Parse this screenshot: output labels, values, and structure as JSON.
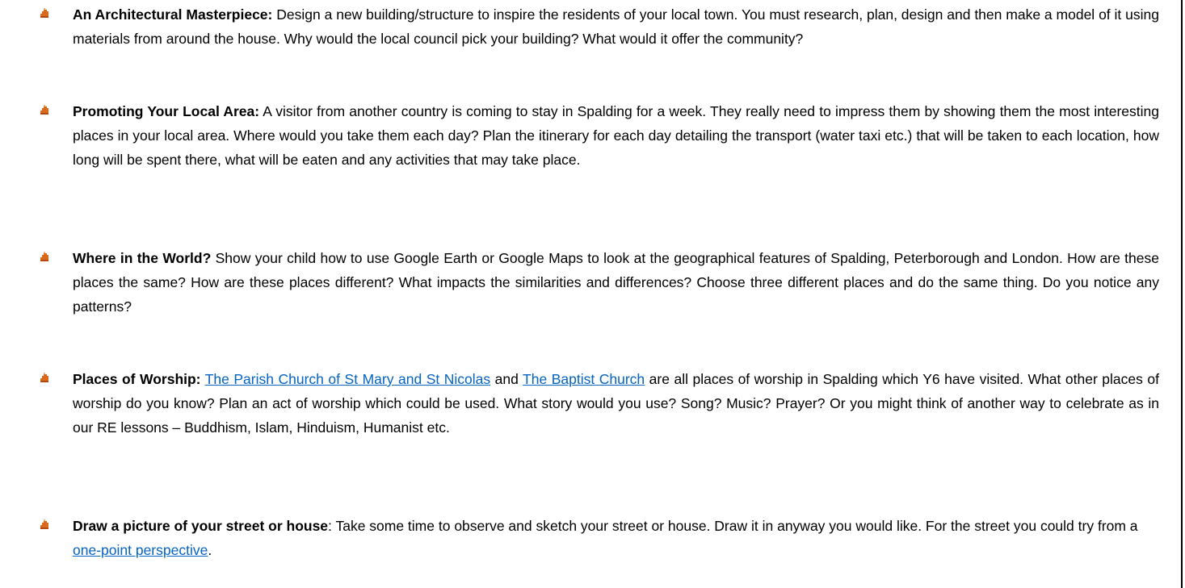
{
  "items": [
    {
      "title": "An Architectural Masterpiece:",
      "text": " Design a new building/structure to inspire the residents of your local town. You must research, plan, design and then make a model of it using materials from around the house. Why would the local council pick your building? What would it offer the community?"
    },
    {
      "title": "Promoting Your Local Area:",
      "text": " A visitor from another country is coming to stay in Spalding for a week. They really need to impress them by showing them the most interesting places in your local area. Where would you take them each day? Plan the itinerary for each day detailing the transport (water taxi etc.) that will be taken to each location, how long will be spent there, what will be eaten and any activities that may take place."
    },
    {
      "title": "Where in the World?",
      "text": " Show your child how to use Google Earth or Google Maps to look at the geographical features of Spalding, Peterborough and London. How are these places the same? How are these places different? What impacts the similarities and differences? Choose three different places and do the same thing. Do you notice any patterns?"
    },
    {
      "title": "Places of Worship:",
      "text_before": " ",
      "link1": "The Parish Church of St Mary and St Nicolas",
      "text_mid": " and ",
      "link2": "The Baptist Church",
      "text_after": " are all places of worship in Spalding which Y6 have visited. What other places of worship do you know? Plan an act of worship which could be used. What story would you use? Song? Music? Prayer? Or you might think of another way to celebrate as in our RE lessons – Buddhism, Islam, Hinduism, Humanist etc."
    },
    {
      "title": "Draw a picture of your street or house",
      "text_before": ": Take some time to observe and sketch your street or house. Draw it in anyway you would like. For the street you could try from a ",
      "link": "one-point perspective",
      "text_after": "."
    }
  ],
  "bullet_icon": "castle-bullet-icon",
  "colors": {
    "link": "#0563c1",
    "bullet": "#d9691c"
  }
}
